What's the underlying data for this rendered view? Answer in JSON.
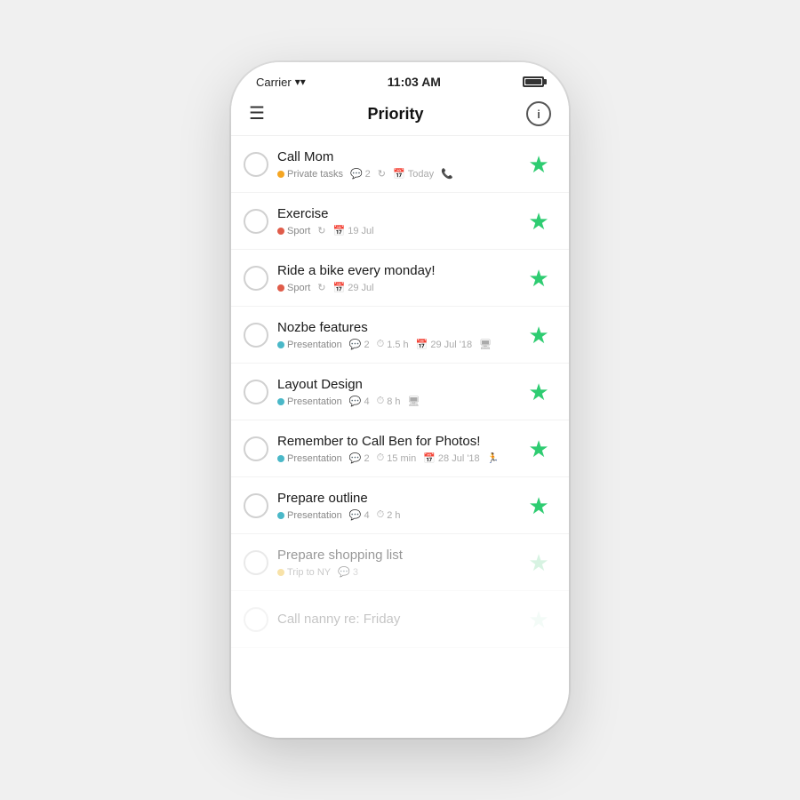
{
  "status_bar": {
    "carrier": "Carrier",
    "time": "11:03 AM"
  },
  "nav": {
    "title": "Priority",
    "menu_label": "☰",
    "info_label": "i"
  },
  "tasks": [
    {
      "id": 1,
      "title": "Call Mom",
      "meta": [
        {
          "type": "tag",
          "dot": "orange",
          "label": "Private tasks"
        },
        {
          "type": "icon",
          "icon": "💬",
          "value": "2"
        },
        {
          "type": "icon",
          "icon": "↻",
          "value": ""
        },
        {
          "type": "icon",
          "icon": "📅",
          "value": "Today"
        },
        {
          "type": "icon",
          "icon": "📞",
          "value": ""
        }
      ],
      "starred": true,
      "faded": false
    },
    {
      "id": 2,
      "title": "Exercise",
      "meta": [
        {
          "type": "tag",
          "dot": "red",
          "label": "Sport"
        },
        {
          "type": "icon",
          "icon": "↻",
          "value": ""
        },
        {
          "type": "icon",
          "icon": "📅",
          "value": "19 Jul"
        }
      ],
      "starred": true,
      "faded": false
    },
    {
      "id": 3,
      "title": "Ride a bike every monday!",
      "meta": [
        {
          "type": "tag",
          "dot": "red",
          "label": "Sport"
        },
        {
          "type": "icon",
          "icon": "↻",
          "value": ""
        },
        {
          "type": "icon",
          "icon": "📅",
          "value": "29 Jul"
        }
      ],
      "starred": true,
      "faded": false
    },
    {
      "id": 4,
      "title": "Nozbe features",
      "meta": [
        {
          "type": "tag",
          "dot": "blue",
          "label": "Presentation"
        },
        {
          "type": "icon",
          "icon": "💬",
          "value": "2"
        },
        {
          "type": "icon",
          "icon": "⏱",
          "value": "1.5 h"
        },
        {
          "type": "icon",
          "icon": "📅",
          "value": "29 Jul '18"
        },
        {
          "type": "icon",
          "icon": "🖥",
          "value": ""
        }
      ],
      "starred": true,
      "faded": false
    },
    {
      "id": 5,
      "title": "Layout Design",
      "meta": [
        {
          "type": "tag",
          "dot": "blue",
          "label": "Presentation"
        },
        {
          "type": "icon",
          "icon": "💬",
          "value": "4"
        },
        {
          "type": "icon",
          "icon": "⏱",
          "value": "8 h"
        },
        {
          "type": "icon",
          "icon": "🖥",
          "value": ""
        }
      ],
      "starred": true,
      "faded": false
    },
    {
      "id": 6,
      "title": "Remember to Call Ben for Photos!",
      "meta": [
        {
          "type": "tag",
          "dot": "blue",
          "label": "Presentation"
        },
        {
          "type": "icon",
          "icon": "💬",
          "value": "2"
        },
        {
          "type": "icon",
          "icon": "⏱",
          "value": "15 min"
        },
        {
          "type": "icon",
          "icon": "📅",
          "value": "28 Jul '18"
        },
        {
          "type": "icon",
          "icon": "🏃",
          "value": ""
        }
      ],
      "starred": true,
      "faded": false
    },
    {
      "id": 7,
      "title": "Prepare outline",
      "meta": [
        {
          "type": "tag",
          "dot": "blue",
          "label": "Presentation"
        },
        {
          "type": "icon",
          "icon": "💬",
          "value": "4"
        },
        {
          "type": "icon",
          "icon": "⏱",
          "value": "2 h"
        }
      ],
      "starred": true,
      "faded": false
    },
    {
      "id": 8,
      "title": "Prepare shopping list",
      "meta": [
        {
          "type": "tag",
          "dot": "yellow",
          "label": "Trip to NY"
        },
        {
          "type": "icon",
          "icon": "💬",
          "value": "3"
        }
      ],
      "starred": true,
      "faded": true
    },
    {
      "id": 9,
      "title": "Call nanny re: Friday",
      "meta": [],
      "starred": true,
      "faded": true,
      "very_faded": true
    }
  ]
}
